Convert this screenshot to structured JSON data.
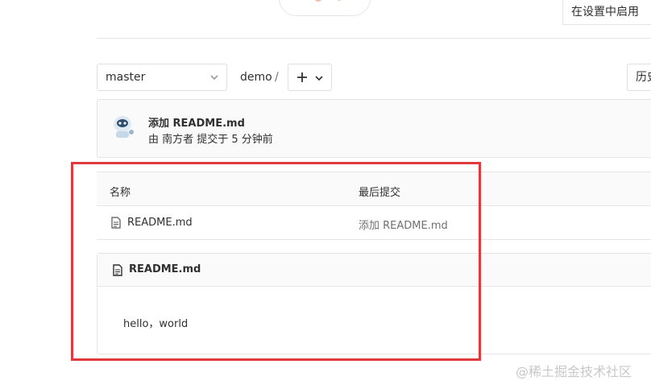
{
  "header": {
    "settings_enable_label": "在设置中启用"
  },
  "repo_nav": {
    "branch": "master",
    "path_root": "demo",
    "path_separator": "/",
    "history_label": "历史"
  },
  "last_commit": {
    "title": "添加 README.md",
    "meta": "由 南方者 提交于 5 分钟前"
  },
  "file_table": {
    "columns": [
      "名称",
      "最后提交"
    ],
    "rows": [
      {
        "name": "README.md",
        "last_commit": "添加 README.md"
      }
    ]
  },
  "readme": {
    "title": "README.md",
    "content": "hello，world"
  },
  "watermark": "@稀土掘金技术社区",
  "colors": {
    "highlight": "#e0393e",
    "border": "#e5e5e5",
    "panel_bg": "#fafafa",
    "text": "#303030",
    "muted_text": "#707070"
  }
}
